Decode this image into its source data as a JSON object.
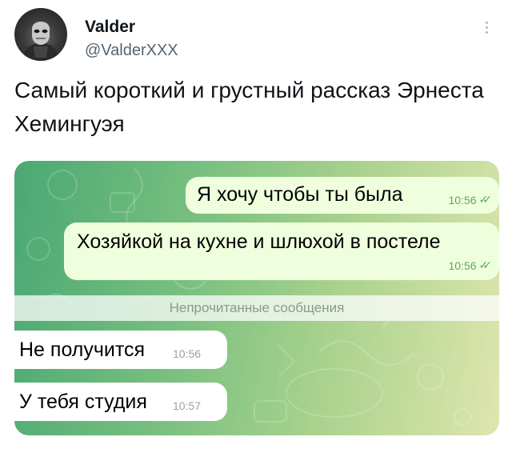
{
  "author": {
    "name": "Valder",
    "handle": "@ValderXXX",
    "avatar_icon": "masked-figure-avatar"
  },
  "tweet": {
    "text": "Самый короткий и грустный рассказ Эрнеста Хемингуэя"
  },
  "chat": {
    "background_colors": [
      "#4aa873",
      "#a9d28d",
      "#dfe6ad"
    ],
    "messages": [
      {
        "direction": "outgoing",
        "text": "Я хочу чтобы ты была",
        "time": "10:56",
        "status_icon": "double-check-icon"
      },
      {
        "direction": "outgoing",
        "text": "Хозяйкой на кухне и шлюхой в постеле",
        "time": "10:56",
        "status_icon": "double-check-icon"
      },
      {
        "direction": "incoming",
        "text": "Не получится",
        "time": "10:56"
      },
      {
        "direction": "incoming",
        "text": "У тебя студия",
        "time": "10:57"
      }
    ],
    "unread_divider": "Непрочитанные сообщения"
  },
  "icons": {
    "more": "more-vertical-icon",
    "ticks": "✓✓"
  }
}
